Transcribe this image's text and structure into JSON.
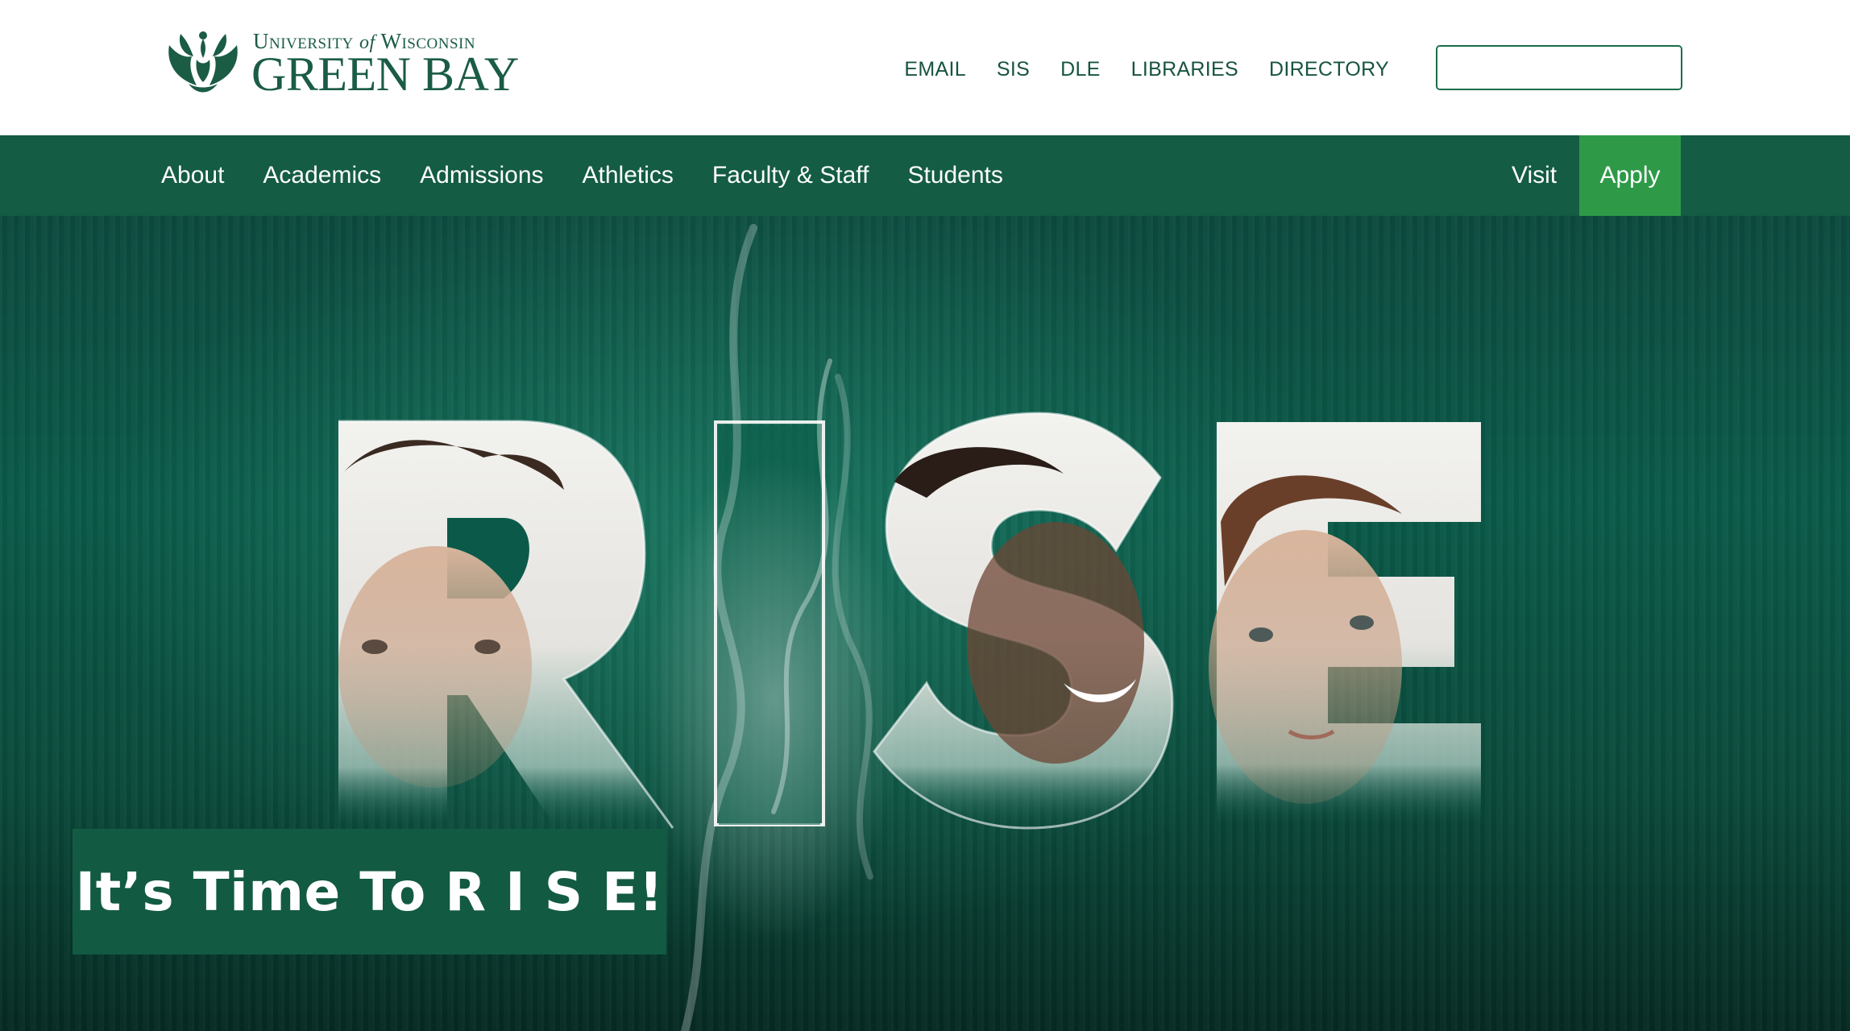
{
  "header": {
    "logo": {
      "line1_prefix": "University",
      "line1_of": "of",
      "line1_suffix": "Wisconsin",
      "line2": "GREEN BAY"
    },
    "utility_links": [
      "EMAIL",
      "SIS",
      "DLE",
      "LIBRARIES",
      "DIRECTORY"
    ],
    "search": {
      "placeholder": "",
      "value": "",
      "icon": "search-icon"
    }
  },
  "nav": {
    "items": [
      "About",
      "Academics",
      "Admissions",
      "Athletics",
      "Faculty & Staff",
      "Students"
    ],
    "visit": "Visit",
    "apply": "Apply"
  },
  "hero": {
    "word": "RISE",
    "caption": "It’s Time To R I S E!"
  },
  "colors": {
    "brand_green": "#145c43",
    "apply_green": "#2e9a48",
    "search_button": "#1b7446",
    "text_green": "#17543e"
  }
}
